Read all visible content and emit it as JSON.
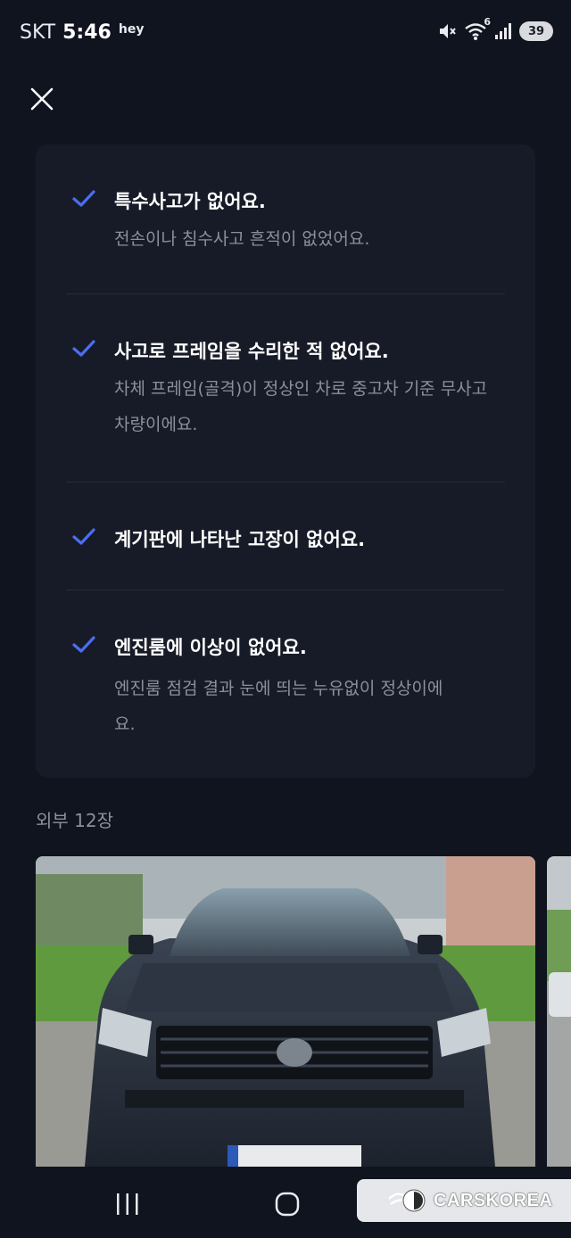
{
  "status_bar": {
    "carrier": "SKT",
    "time": "5:46",
    "note": "hey",
    "wifi_badge": "6",
    "battery": "39"
  },
  "checks": [
    {
      "title": "특수사고가 없어요.",
      "desc": "전손이나 침수사고 흔적이 없었어요."
    },
    {
      "title": "사고로 프레임을 수리한 적 없어요.",
      "desc": "차체 프레임(골격)이 정상인 차로 중고차 기준 무사고 차량이에요."
    },
    {
      "title": "계기판에 나타난 고장이 없어요.",
      "desc": ""
    },
    {
      "title": "엔진룸에 이상이 없어요.",
      "desc": "엔진룸 점검 결과 눈에 띄는 누유없이 정상이에요."
    }
  ],
  "section": {
    "label": "외부 12장"
  },
  "watermark": {
    "text": "CARSKOREA"
  },
  "colors": {
    "accent": "#4a6ef0",
    "background": "#0f141f",
    "card": "#161b27",
    "muted": "#8a909c"
  }
}
